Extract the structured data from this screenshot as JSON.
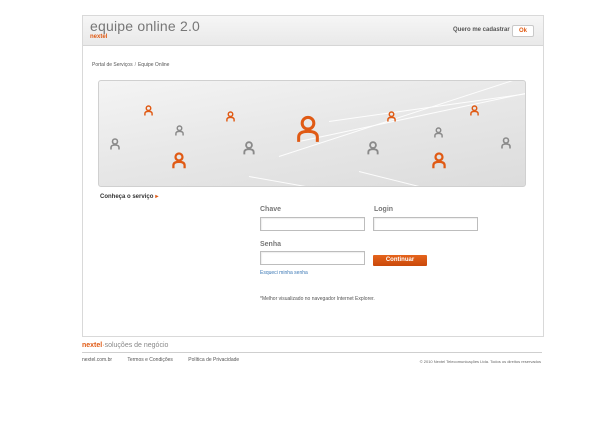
{
  "header": {
    "app_title": "equipe online 2.0",
    "brand": "nextel",
    "register_label": "Quero me cadastrar",
    "ok_label": "Ok"
  },
  "breadcrumb": {
    "items": [
      "Portal de Serviços",
      "Equipe Online"
    ],
    "separator": "/"
  },
  "banner": {
    "icon": "person-icon",
    "accent_color": "#e05a14",
    "neutral_color": "#8a8a8a"
  },
  "section": {
    "title": "Conheça o serviço",
    "arrow": "▸"
  },
  "form": {
    "chave_label": "Chave",
    "chave_value": "",
    "login_label": "Login",
    "login_value": "",
    "senha_label": "Senha",
    "senha_value": "",
    "continue_label": "Continuar",
    "forgot_label": "Esqueci minha senha",
    "note": "*Melhor visualizado no navegador Internet Explorer."
  },
  "footer": {
    "brand": "nextel",
    "tagline": "soluções de negócio",
    "links": [
      "nextel.com.br",
      "Termos e Condições",
      "Política de Privacidade"
    ],
    "copyright": "© 2010 Nextel Telecomunicações Ltda. Todos os direitos reservados"
  }
}
